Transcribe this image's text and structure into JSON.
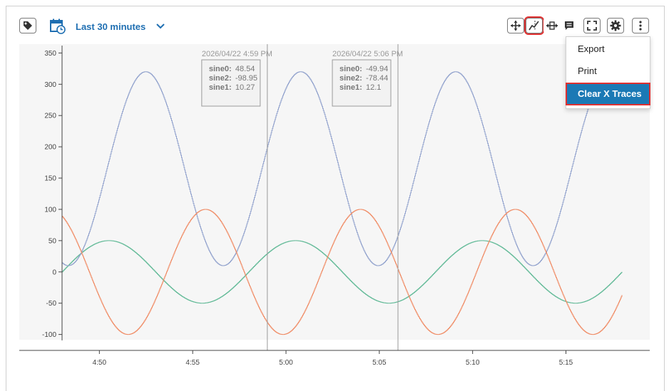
{
  "toolbar": {
    "time_range_label": "Last 30 minutes",
    "left_icons": [
      "tag-icon",
      "calendar-clock-icon",
      "chevron-down-icon"
    ],
    "right_icons": [
      "pan-move-icon",
      "x-trace-icon",
      "horizontal-scale-icon",
      "notes-icon",
      "fullscreen-icon",
      "settings-gear-icon",
      "more-vertical-icon"
    ]
  },
  "menu": {
    "items": [
      "Export",
      "Print",
      "Clear X Traces"
    ],
    "selected_index": 2
  },
  "tooltips": [
    {
      "header": "2026/04/22 4:59 PM",
      "rows": [
        {
          "label": "sine0:",
          "value": "48.54"
        },
        {
          "label": "sine2:",
          "value": "-98.95"
        },
        {
          "label": "sine1:",
          "value": "10.27"
        }
      ]
    },
    {
      "header": "2026/04/22 5:06 PM",
      "rows": [
        {
          "label": "sine0:",
          "value": "-49.94"
        },
        {
          "label": "sine2:",
          "value": "-78.44"
        },
        {
          "label": "sine1:",
          "value": "12.1"
        }
      ]
    }
  ],
  "colors": {
    "sine0": "#5db894",
    "sine1": "#8fa0cc",
    "sine2": "#f08a63",
    "accent": "#1b79b5",
    "highlight": "#e03030"
  },
  "chart_data": {
    "type": "line",
    "x_tick_labels": [
      "4:50",
      "4:55",
      "5:00",
      "5:05",
      "5:10",
      "5:15"
    ],
    "y_ticks": [
      350,
      300,
      250,
      200,
      150,
      100,
      50,
      0,
      -50,
      -100
    ],
    "ylim": [
      -105,
      355
    ],
    "x_range_minutes": [
      "4:48",
      "5:18"
    ],
    "trace_times": [
      "4:59",
      "5:06"
    ],
    "series": [
      {
        "name": "sine0",
        "amplitude": 50,
        "offset": 0,
        "period_min": 10,
        "phase_min": 0.0
      },
      {
        "name": "sine1",
        "amplitude": 155,
        "offset": 165,
        "period_min": 8.3,
        "phase_min": 2.4
      },
      {
        "name": "sine2",
        "amplitude": 100,
        "offset": 0,
        "period_min": 8.3,
        "phase_min": 5.6
      }
    ]
  }
}
